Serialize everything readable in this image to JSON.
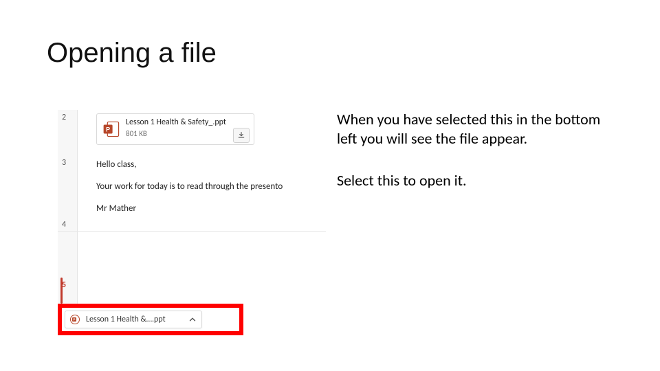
{
  "title": "Opening a file",
  "rail_numbers": {
    "n2": "2",
    "n3": "3",
    "n4": "4",
    "n5": "5"
  },
  "attachment": {
    "filename": "Lesson 1 Health & Safety_.ppt",
    "size": "801 KB"
  },
  "message": {
    "greeting": "Hello class,",
    "body": "Your work for today is to read through the presento",
    "signature": "Mr Mather"
  },
  "download_bar": {
    "label": "Lesson 1 Health &….ppt"
  },
  "instructions": {
    "p1": "When you have selected this in the bottom left you will see the file appear.",
    "p2": "Select this to open it."
  }
}
